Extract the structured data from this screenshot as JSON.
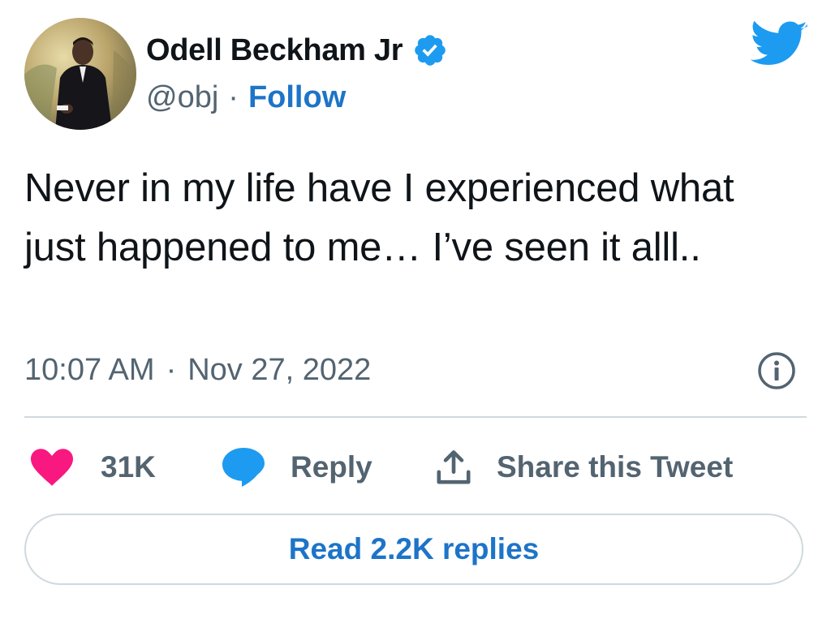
{
  "author": {
    "display_name": "Odell Beckham Jr",
    "handle": "@obj",
    "separator": "·",
    "follow_label": "Follow",
    "verified_icon": "verified-badge-icon",
    "avatar": "avatar-photo"
  },
  "brand_icon": "twitter-bird-icon",
  "tweet": {
    "text": "Never in my life have I experienced what just happened to me… I’ve seen it alll..",
    "time": "10:07 AM",
    "separator": "·",
    "date": "Nov 27, 2022",
    "info_icon": "info-icon"
  },
  "actions": {
    "like_count": "31K",
    "like_icon": "heart-icon",
    "reply_label": "Reply",
    "reply_icon": "speech-bubble-icon",
    "share_label": "Share this Tweet",
    "share_icon": "share-upload-icon"
  },
  "read_replies_label": "Read 2.2K replies",
  "colors": {
    "link_blue": "#1d74c8",
    "twitter_blue": "#1d9bf0",
    "heart_pink": "#f91880",
    "secondary_text": "#536471",
    "divider": "#cfd9de"
  }
}
